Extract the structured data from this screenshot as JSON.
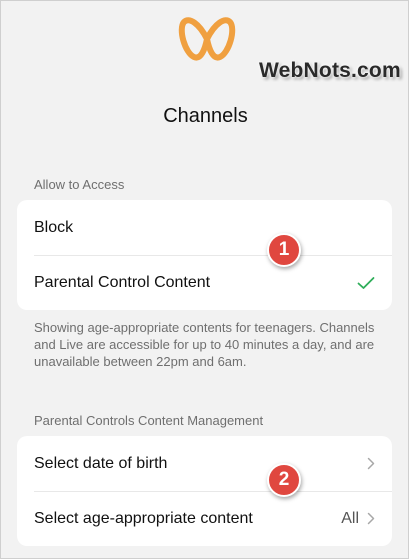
{
  "watermark": "WebNots.com",
  "title": "Channels",
  "allow_section": {
    "header": "Allow to Access",
    "rows": [
      {
        "label": "Block"
      },
      {
        "label": "Parental Control Content",
        "selected": true
      }
    ],
    "description": "Showing age-appropriate contents for teenagers. Channels and Live are accessible for up to 40 minutes a day, and are unavailable between 22pm and 6am."
  },
  "management_section": {
    "header": "Parental Controls Content Management",
    "rows": [
      {
        "label": "Select date of birth"
      },
      {
        "label": "Select age-appropriate content",
        "value": "All"
      }
    ]
  },
  "annotations": [
    "1",
    "2"
  ],
  "colors": {
    "logo_orange": "#f0a040",
    "check_green": "#2fae5a",
    "badge_red": "#e0473f",
    "background": "#f2f2f2"
  },
  "icons": {
    "logo": "butterfly-logo-icon",
    "selected": "checkmark-icon",
    "disclosure": "chevron-right-icon"
  }
}
